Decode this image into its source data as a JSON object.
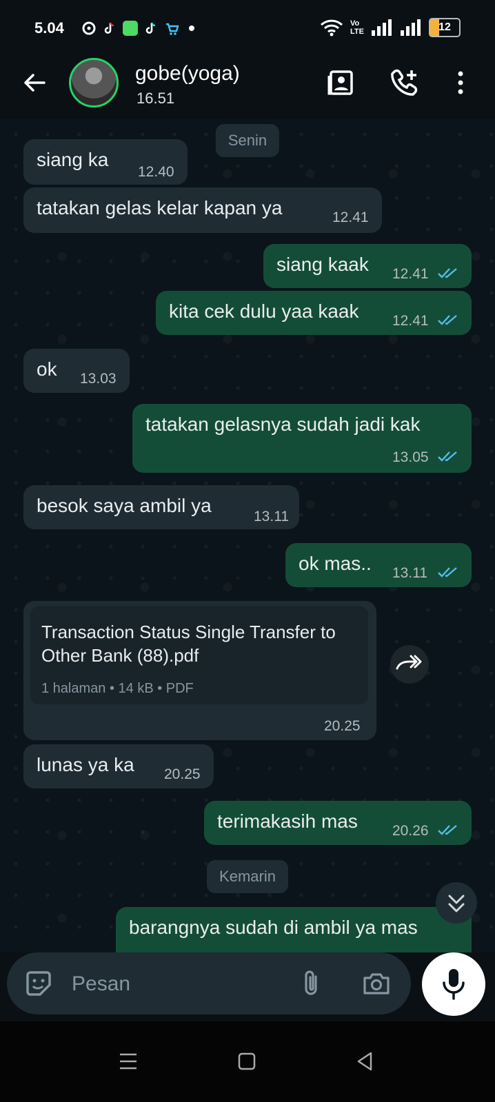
{
  "status_bar": {
    "time": "5.04",
    "volte_label": "Vo",
    "lte_label": "LTE",
    "battery_level": "12",
    "battery_color": "#f2b33d",
    "notification_icons": [
      "location-icon",
      "tiktok-icon",
      "messages-icon",
      "tiktok-icon",
      "shop-icon",
      "dot-icon"
    ]
  },
  "header": {
    "contact_name": "gobe(yoga)",
    "subtitle": "16.51",
    "accent_color": "#25d366",
    "icons": [
      "back-arrow-icon",
      "contact-card-icon",
      "add-call-icon",
      "more-vert-icon"
    ]
  },
  "chat": {
    "day_separators": [
      "Senin",
      "Kemarin"
    ],
    "messages": [
      {
        "dir": "in",
        "text": "siang ka",
        "time": "12.40"
      },
      {
        "dir": "in",
        "text": "tatakan gelas kelar kapan ya",
        "time": "12.41"
      },
      {
        "dir": "out",
        "text": "siang kaak",
        "time": "12.41",
        "status": "read"
      },
      {
        "dir": "out",
        "text": "kita cek dulu yaa kaak",
        "time": "12.41",
        "status": "read"
      },
      {
        "dir": "in",
        "text": "ok",
        "time": "13.03"
      },
      {
        "dir": "out",
        "text": "tatakan gelasnya sudah jadi kak",
        "time": "13.05",
        "status": "read"
      },
      {
        "dir": "in",
        "text": "besok saya ambil ya",
        "time": "13.11"
      },
      {
        "dir": "out",
        "text": "ok mas..",
        "time": "13.11",
        "status": "read"
      },
      {
        "dir": "in",
        "type": "document",
        "doc_title": "Transaction Status Single Transfer to Other Bank (88).pdf",
        "doc_meta": "1 halaman • 14 kB • PDF",
        "time": "20.25"
      },
      {
        "dir": "in",
        "text": "lunas ya ka",
        "time": "20.25"
      },
      {
        "dir": "out",
        "text": "terimakasih mas",
        "time": "20.26",
        "status": "read"
      },
      {
        "dir": "out",
        "text": "barangnya sudah di ambil ya mas",
        "time": ""
      }
    ],
    "colors": {
      "incoming_bubble": "#1f2c34",
      "outgoing_bubble": "#144d37",
      "read_ticks": "#53bdeb"
    }
  },
  "composer": {
    "placeholder": "Pesan",
    "icons": [
      "sticker-icon",
      "attach-icon",
      "camera-icon",
      "mic-icon"
    ]
  },
  "nav_bar": {
    "icons": [
      "recents-icon",
      "home-icon",
      "back-icon"
    ]
  }
}
